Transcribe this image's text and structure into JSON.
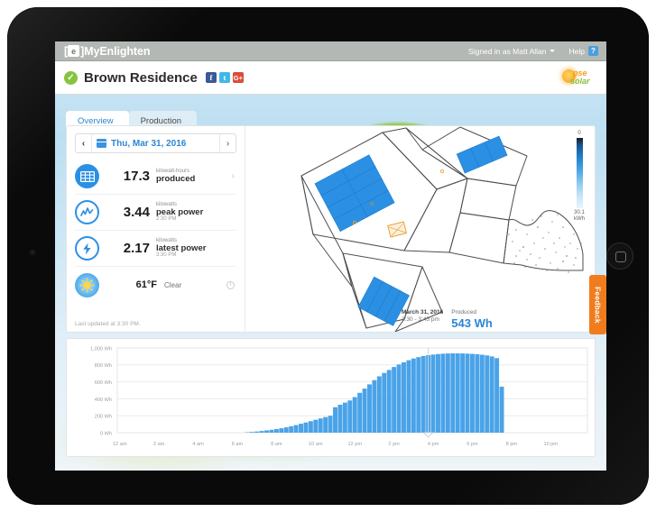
{
  "device": {
    "home_button": "home-button",
    "camera": "front-camera"
  },
  "topbar": {
    "brand_mark": "e",
    "brand_name": "MyEnlighten",
    "signed_in": "Signed in as Matt Allan",
    "help_label": "Help",
    "help_badge": "?"
  },
  "header": {
    "check_glyph": "✓",
    "site_title": "Brown Residence",
    "social": [
      {
        "name": "facebook",
        "glyph": "f"
      },
      {
        "name": "twitter",
        "glyph": "t"
      },
      {
        "name": "google-plus",
        "glyph": "G+"
      }
    ],
    "partner_logo": {
      "top_text": "pse",
      "bottom_text": "solar"
    }
  },
  "tabs": [
    {
      "label": "Overview",
      "active": true
    },
    {
      "label": "Production",
      "active": false
    }
  ],
  "date_picker": {
    "prev_glyph": "‹",
    "next_glyph": "›",
    "value": "Thu, Mar 31, 2016"
  },
  "metrics": [
    {
      "icon": "solar-panel-icon",
      "value": "17.3",
      "unit": "kilowatt-hours",
      "label": "produced",
      "time": "",
      "action": "chevron-right-icon",
      "action_glyph": "›"
    },
    {
      "icon": "peak-power-icon",
      "value": "3.44",
      "unit": "kilowatts",
      "label": "peak power",
      "time": "2:30 PM",
      "action": "",
      "action_glyph": ""
    },
    {
      "icon": "latest-power-icon",
      "value": "2.17",
      "unit": "kilowatts",
      "label": "latest power",
      "time": "3:30 PM",
      "action": "",
      "action_glyph": ""
    }
  ],
  "weather": {
    "icon": "sun-icon",
    "temperature": "61°F",
    "condition": "Clear",
    "info_glyph": "i"
  },
  "last_updated": "Last updated at 3:30 PM.",
  "map": {
    "legend_min": "0",
    "legend_max": "30.1 kWh",
    "panel_color": "#2b90e4",
    "outline_color": "#4b4f52"
  },
  "feedback": {
    "label": "Feedback",
    "color": "#f07c1e"
  },
  "callout": {
    "date": "March 31, 2016",
    "range": "3:30 - 3:45 pm",
    "produced_label": "Produced",
    "produced_value": "543 Wh"
  },
  "chart_data": {
    "type": "bar",
    "title": "",
    "xlabel": "",
    "ylabel": "Wh",
    "ylim": [
      0,
      1000
    ],
    "grid": true,
    "legend": "none",
    "bar_color": "#4aa3e8",
    "y_ticks": [
      "0 Wh",
      "200 Wh",
      "400 Wh",
      "600 Wh",
      "800 Wh",
      "1,000 Wh"
    ],
    "y_tick_values": [
      0,
      200,
      400,
      600,
      800,
      1000
    ],
    "x_ticks": [
      "12 am",
      "2 am",
      "4 am",
      "6 am",
      "8 am",
      "10 am",
      "12 pm",
      "2 pm",
      "4 pm",
      "6 pm",
      "8 pm",
      "10 pm"
    ],
    "x_tick_hours": [
      0,
      2,
      4,
      6,
      8,
      10,
      12,
      14,
      16,
      18,
      20,
      22
    ],
    "interval_minutes": 15,
    "highlight_index": 63,
    "highlight_value": 543,
    "values": [
      0,
      0,
      0,
      0,
      0,
      0,
      0,
      0,
      0,
      0,
      0,
      0,
      0,
      0,
      0,
      0,
      0,
      0,
      0,
      0,
      0,
      0,
      0,
      0,
      0,
      0,
      5,
      9,
      14,
      20,
      27,
      34,
      42,
      52,
      63,
      76,
      90,
      105,
      120,
      136,
      152,
      168,
      184,
      200,
      300,
      330,
      355,
      380,
      420,
      470,
      520,
      570,
      620,
      665,
      705,
      740,
      775,
      805,
      830,
      855,
      875,
      892,
      905,
      915,
      922,
      928,
      932,
      935,
      936,
      936,
      935,
      933,
      930,
      926,
      920,
      912,
      900,
      880,
      543,
      0,
      0,
      0,
      0,
      0,
      0,
      0,
      0,
      0,
      0,
      0,
      0,
      0,
      0,
      0,
      0,
      0
    ]
  }
}
